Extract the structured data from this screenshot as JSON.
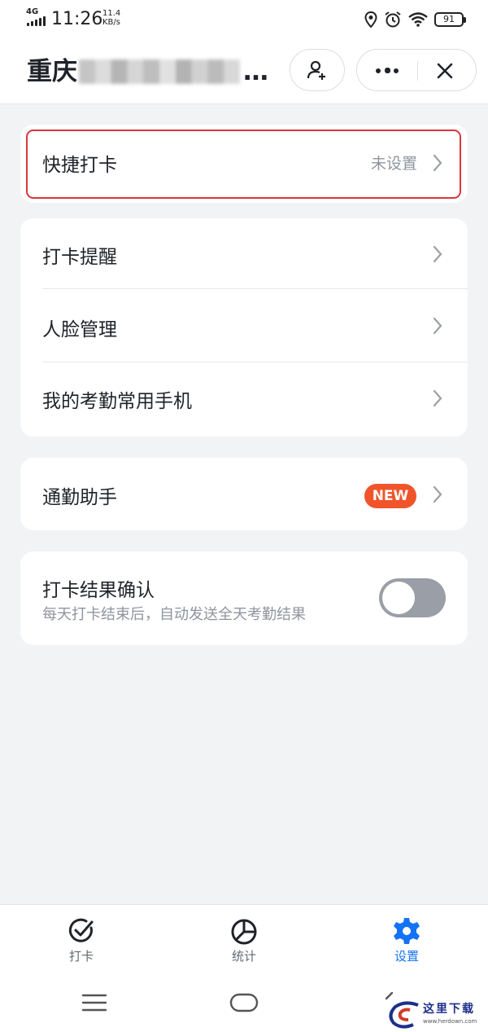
{
  "status_bar": {
    "network": "4G",
    "time": "11:26",
    "speed_value": "11.4",
    "speed_unit": "KB/s",
    "battery": "91",
    "icons": [
      "location-icon",
      "alarm-icon",
      "wifi-icon",
      "battery-icon"
    ]
  },
  "header": {
    "title_prefix": "重庆",
    "title_suffix": "…",
    "icons": [
      "add-member-icon",
      "more-icon",
      "close-icon"
    ]
  },
  "settings": {
    "quick_checkin": {
      "label": "快捷打卡",
      "status": "未设置"
    },
    "group": [
      {
        "label": "打卡提醒"
      },
      {
        "label": "人脸管理"
      },
      {
        "label": "我的考勤常用手机"
      }
    ],
    "commute": {
      "label": "通勤助手",
      "badge": "NEW"
    },
    "result_confirm": {
      "label": "打卡结果确认",
      "description": "每天打卡结束后，自动发送全天考勤结果",
      "enabled": false
    }
  },
  "tabbar": {
    "tabs": [
      {
        "label": "打卡",
        "icon": "checkin-icon",
        "active": false
      },
      {
        "label": "统计",
        "icon": "statistics-icon",
        "active": false
      },
      {
        "label": "设置",
        "icon": "settings-gear-icon",
        "active": true
      }
    ]
  },
  "watermark": {
    "text": "这里下载",
    "url": "www.herdown.com"
  },
  "colors": {
    "accent": "#1473f5",
    "highlight_border": "#d9363e",
    "badge": "#f0542a",
    "background": "#f2f3f5"
  }
}
